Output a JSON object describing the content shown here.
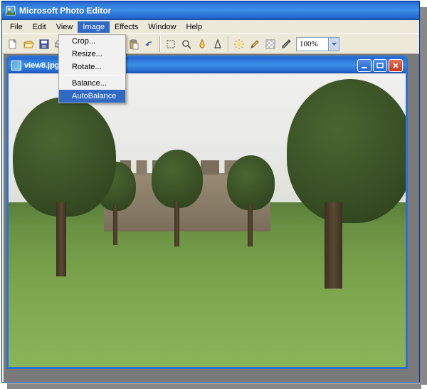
{
  "app": {
    "title": "Microsoft Photo Editor"
  },
  "menubar": {
    "items": [
      "File",
      "Edit",
      "View",
      "Image",
      "Effects",
      "Window",
      "Help"
    ],
    "open_index": 3
  },
  "dropdown": {
    "items": [
      {
        "label": "Crop...",
        "highlighted": false
      },
      {
        "label": "Resize...",
        "highlighted": false
      },
      {
        "label": "Rotate...",
        "highlighted": false
      }
    ],
    "items2": [
      {
        "label": "Balance...",
        "highlighted": false
      },
      {
        "label": "AutoBalance",
        "highlighted": true
      }
    ]
  },
  "toolbar": {
    "zoom_value": "100%"
  },
  "document": {
    "title": "view8.jpg"
  }
}
